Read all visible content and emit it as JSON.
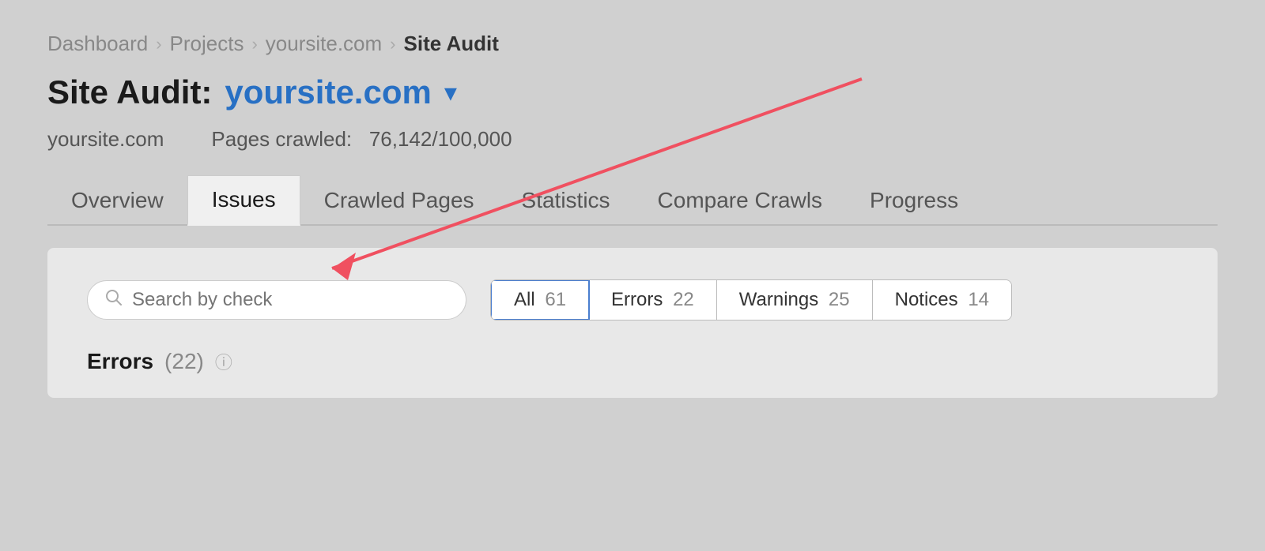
{
  "breadcrumb": {
    "items": [
      {
        "label": "Dashboard",
        "active": false
      },
      {
        "label": "Projects",
        "active": false
      },
      {
        "label": "yoursite.com",
        "active": false
      },
      {
        "label": "Site Audit",
        "active": true
      }
    ],
    "separators": [
      ">",
      ">",
      ">"
    ]
  },
  "title": {
    "label": "Site Audit:",
    "site": "yoursite.com",
    "chevron": "▾"
  },
  "subtitle": {
    "site": "yoursite.com",
    "pages_crawled_label": "Pages crawled:",
    "pages_crawled_value": "76,142/100,000"
  },
  "nav": {
    "tabs": [
      {
        "label": "Overview",
        "active": false
      },
      {
        "label": "Issues",
        "active": true
      },
      {
        "label": "Crawled Pages",
        "active": false
      },
      {
        "label": "Statistics",
        "active": false
      },
      {
        "label": "Compare Crawls",
        "active": false
      },
      {
        "label": "Progress",
        "active": false
      }
    ]
  },
  "filter": {
    "search_placeholder": "Search by check",
    "buttons": [
      {
        "label": "All",
        "count": "61",
        "active": true
      },
      {
        "label": "Errors",
        "count": "22",
        "active": false
      },
      {
        "label": "Warnings",
        "count": "25",
        "active": false
      },
      {
        "label": "Notices",
        "count": "14",
        "active": false
      }
    ]
  },
  "errors_section": {
    "label": "Errors",
    "count": "(22)"
  },
  "colors": {
    "accent_blue": "#2870c4",
    "active_border": "#4a7ecf",
    "arrow_red": "#f05060"
  }
}
